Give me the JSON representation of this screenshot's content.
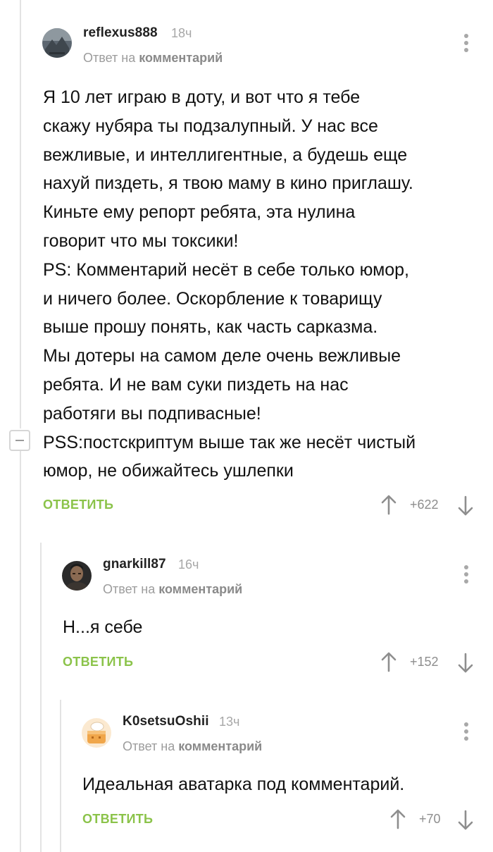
{
  "comments": [
    {
      "username": "reflexus888",
      "time": "18ч",
      "reply_prefix": "Ответ на",
      "reply_target": "комментарий",
      "lines": [
        "Я 10 лет играю в доту, и вот что я тебе",
        "скажу нубяра ты подзалупный. У нас все",
        "вежливые, и интеллигентные, а будешь еще",
        "нахуй пиздеть, я твою маму в кино приглашу.",
        "Киньте ему репорт ребята, эта нулина",
        "говорит что мы токсики!",
        "PS: Комментарий несёт в себе только юмор,",
        "и ничего более. Оскорбление к товарищу",
        "выше прошу понять, как часть сарказма.",
        "Мы дотеры на самом деле очень вежливые",
        "ребята. И не вам суки пиздеть на нас",
        "работяги вы подпивасные!",
        "PSS:постскриптум выше так же несёт чистый",
        "юмор, не обижайтесь ушлепки"
      ],
      "reply_label": "ОТВЕТИТЬ",
      "rating": "+622"
    },
    {
      "username": "gnarkill87",
      "time": "16ч",
      "reply_prefix": "Ответ на",
      "reply_target": "комментарий",
      "lines": [
        "Н...я себе"
      ],
      "reply_label": "ОТВЕТИТЬ",
      "rating": "+152"
    },
    {
      "username": "K0setsuOshii",
      "time": "13ч",
      "reply_prefix": "Ответ на",
      "reply_target": "комментарий",
      "lines": [
        "Идеальная аватарка под комментарий."
      ],
      "reply_label": "ОТВЕТИТЬ",
      "rating": "+70"
    }
  ],
  "colors": {
    "accent_green": "#8bc34a",
    "muted_text": "#9c9c9c",
    "thread_line": "#e3e3e3"
  },
  "icons": [
    "collapse-thread-icon",
    "more-options-icon",
    "upvote-arrow-icon",
    "downvote-arrow-icon"
  ]
}
